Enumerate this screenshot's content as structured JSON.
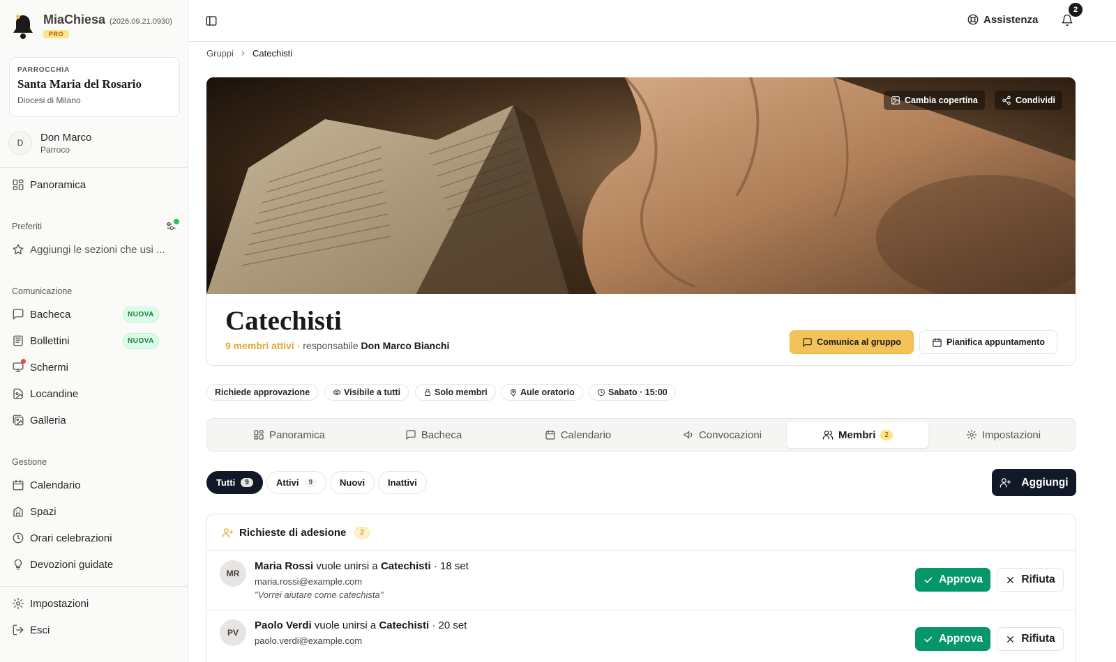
{
  "app": {
    "name": "MiaChiesa",
    "version": "(2026.09.21.0930)",
    "plan_badge": "PRO"
  },
  "parish": {
    "kicker": "PARROCCHIA",
    "name": "Santa Maria del Rosario",
    "diocese": "Diocesi di Milano"
  },
  "user": {
    "initial": "D",
    "name": "Don Marco",
    "role": "Parroco"
  },
  "sidebar": {
    "overview": "Panoramica",
    "favorites_title": "Preferiti",
    "favorites_hint": "Aggiungi le sezioni che usi ...",
    "communication_title": "Comunicazione",
    "communication": [
      {
        "label": "Bacheca",
        "icon": "message-square-icon",
        "badge": "NUOVA"
      },
      {
        "label": "Bollettini",
        "icon": "newspaper-icon",
        "badge": "NUOVA"
      },
      {
        "label": "Schermi",
        "icon": "monitor-icon",
        "badge": ""
      },
      {
        "label": "Locandine",
        "icon": "file-image-icon",
        "badge": ""
      },
      {
        "label": "Galleria",
        "icon": "images-icon",
        "badge": ""
      }
    ],
    "management_title": "Gestione",
    "management": [
      {
        "label": "Calendario",
        "icon": "calendar-icon"
      },
      {
        "label": "Spazi",
        "icon": "building-icon"
      },
      {
        "label": "Orari celebrazioni",
        "icon": "clock-icon"
      },
      {
        "label": "Devozioni guidate",
        "icon": "lightbulb-icon"
      }
    ],
    "settings": "Impostazioni",
    "logout": "Esci"
  },
  "topbar": {
    "help": "Assistenza",
    "notifications_count": "2"
  },
  "breadcrumb": {
    "parent": "Gruppi",
    "current": "Catechisti"
  },
  "cover": {
    "change_cover": "Cambia copertina",
    "share": "Condividi"
  },
  "group": {
    "title": "Catechisti",
    "active_members": "9 membri attivi",
    "responsible_prefix": "· responsabile",
    "responsible_name": "Don Marco Bianchi",
    "contact_button": "Comunica al gruppo",
    "schedule_button": "Pianifica appuntamento"
  },
  "chips": [
    {
      "label": "Richiede approvazione",
      "icon": ""
    },
    {
      "label": "Visibile a tutti",
      "icon": "eye-icon"
    },
    {
      "label": "Solo membri",
      "icon": "lock-icon"
    },
    {
      "label": "Aule oratorio",
      "icon": "map-pin-icon"
    },
    {
      "label": "Sabato · 15:00",
      "icon": "clock-icon"
    }
  ],
  "tabs": [
    {
      "label": "Panoramica",
      "icon": "grid-icon",
      "count": ""
    },
    {
      "label": "Bacheca",
      "icon": "message-square-icon",
      "count": ""
    },
    {
      "label": "Calendario",
      "icon": "calendar-icon",
      "count": ""
    },
    {
      "label": "Convocazioni",
      "icon": "megaphone-icon",
      "count": ""
    },
    {
      "label": "Membri",
      "icon": "users-icon",
      "count": "2",
      "active": true
    },
    {
      "label": "Impostazioni",
      "icon": "gear-icon",
      "count": ""
    }
  ],
  "filters": [
    {
      "label": "Tutti",
      "count": "9",
      "active": true
    },
    {
      "label": "Attivi",
      "count": "9"
    },
    {
      "label": "Nuovi",
      "count": ""
    },
    {
      "label": "Inattivi",
      "count": ""
    }
  ],
  "add_button": "Aggiungi",
  "requests": {
    "title": "Richieste di adesione",
    "count": "2",
    "items": [
      {
        "initials": "MR",
        "name": "Maria Rossi",
        "verb": "vuole unirsi a",
        "group": "Catechisti",
        "date": "· 18 set",
        "email": "maria.rossi@example.com",
        "message": "\"Vorrei aiutare come catechista\""
      },
      {
        "initials": "PV",
        "name": "Paolo Verdi",
        "verb": "vuole unirsi a",
        "group": "Catechisti",
        "date": "· 20 set",
        "email": "paolo.verdi@example.com",
        "message": ""
      }
    ],
    "approve": "Approva",
    "reject": "Rifiuta"
  },
  "colors": {
    "accent": "#f3c35a",
    "dark": "#111827",
    "success": "#059669",
    "new_badge": "#dcfce7"
  }
}
